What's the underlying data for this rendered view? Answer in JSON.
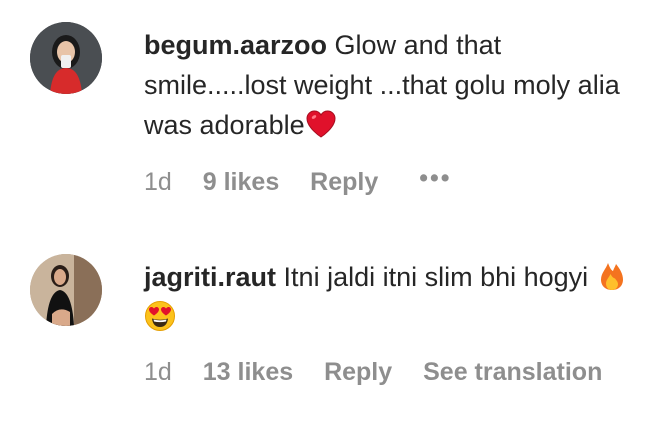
{
  "comments": [
    {
      "username": "begum.aarzoo",
      "text": "Glow and that smile.....lost weight ...that golu moly alia was adorable",
      "emojis": [
        "red-heart"
      ],
      "time": "1d",
      "likes": "9 likes",
      "reply": "Reply",
      "more": "•••"
    },
    {
      "username": "jagriti.raut",
      "text": "Itni jaldi itni slim bhi hogyi",
      "emojis": [
        "fire",
        "smiling-face-with-heart-eyes"
      ],
      "time": "1d",
      "likes": "13 likes",
      "reply": "Reply",
      "translate": "See translation"
    }
  ],
  "colors": {
    "primary_text": "#262626",
    "secondary_text": "#8e8e8e",
    "background": "#ffffff"
  }
}
